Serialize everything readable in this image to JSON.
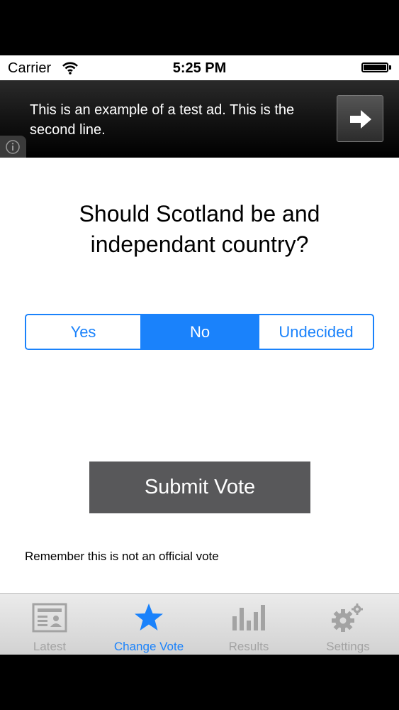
{
  "status_bar": {
    "carrier": "Carrier",
    "time": "5:25 PM"
  },
  "ad": {
    "text": "This is an example of a test ad. This is the second line."
  },
  "question": "Should Scotland be and independant country?",
  "options": [
    {
      "label": "Yes",
      "selected": false
    },
    {
      "label": "No",
      "selected": true
    },
    {
      "label": "Undecided",
      "selected": false
    }
  ],
  "submit_label": "Submit Vote",
  "note": "Remember this is not an official vote",
  "tabs": [
    {
      "label": "Latest",
      "icon": "news-card-icon",
      "active": false
    },
    {
      "label": "Change Vote",
      "icon": "star-icon",
      "active": true
    },
    {
      "label": "Results",
      "icon": "bar-chart-icon",
      "active": false
    },
    {
      "label": "Settings",
      "icon": "gear-icon",
      "active": false
    }
  ],
  "colors": {
    "accent": "#1a82fb",
    "submit_bg": "#58585a",
    "inactive_tab": "#a3a3a3"
  }
}
